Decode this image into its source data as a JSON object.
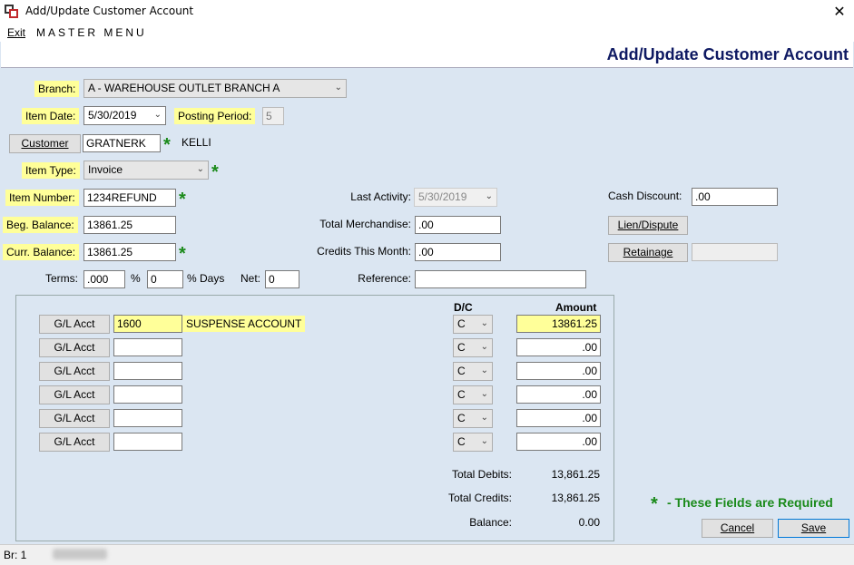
{
  "window": {
    "title": "Add/Update Customer Account",
    "close_glyph": "✕"
  },
  "menu": {
    "exit": "Exit",
    "master": "MASTER MENU"
  },
  "header": {
    "title": "Add/Update Customer Account"
  },
  "form": {
    "branch_label": "Branch:",
    "branch_value": "A  - WAREHOUSE OUTLET BRANCH A",
    "item_date_label": "Item Date:",
    "item_date_value": "5/30/2019",
    "posting_period_label": "Posting Period:",
    "posting_period_value": "5",
    "customer_button": "Customer",
    "customer_value": "GRATNERK",
    "customer_name": "KELLI",
    "item_type_label": "Item Type:",
    "item_type_value": "Invoice",
    "item_number_label": "Item Number:",
    "item_number_value": "1234REFUND",
    "beg_balance_label": "Beg. Balance:",
    "beg_balance_value": "13861.25",
    "curr_balance_label": "Curr. Balance:",
    "curr_balance_value": "13861.25",
    "terms_label": "Terms:",
    "terms_value": ".000",
    "percent_label": "%",
    "days_value": "0",
    "days_label": "% Days",
    "net_label": "Net:",
    "net_value": "0",
    "last_activity_label": "Last Activity:",
    "last_activity_value": "5/30/2019",
    "total_merch_label": "Total Merchandise:",
    "total_merch_value": ".00",
    "credits_month_label": "Credits This Month:",
    "credits_month_value": ".00",
    "reference_label": "Reference:",
    "reference_value": "",
    "cash_discount_label": "Cash Discount:",
    "cash_discount_value": ".00",
    "lien_button": "Lien/Dispute",
    "retainage_button": "Retainage",
    "retainage_value": "",
    "star": "*"
  },
  "gl": {
    "dc_header": "D/C",
    "amount_header": "Amount",
    "button_label": "G/L Acct",
    "rows": [
      {
        "acct": "1600",
        "desc": "SUSPENSE ACCOUNT",
        "dc": "C",
        "amount": "13861.25"
      },
      {
        "acct": "",
        "desc": "",
        "dc": "C",
        "amount": ".00"
      },
      {
        "acct": "",
        "desc": "",
        "dc": "C",
        "amount": ".00"
      },
      {
        "acct": "",
        "desc": "",
        "dc": "C",
        "amount": ".00"
      },
      {
        "acct": "",
        "desc": "",
        "dc": "C",
        "amount": ".00"
      },
      {
        "acct": "",
        "desc": "",
        "dc": "C",
        "amount": ".00"
      }
    ],
    "total_debits_label": "Total Debits:",
    "total_debits_value": "13,861.25",
    "total_credits_label": "Total Credits:",
    "total_credits_value": "13,861.25",
    "balance_label": "Balance:",
    "balance_value": "0.00"
  },
  "footer": {
    "required_note": "- These Fields are Required",
    "cancel": "Cancel",
    "save": "Save"
  },
  "status": {
    "branch": "Br: 1"
  }
}
